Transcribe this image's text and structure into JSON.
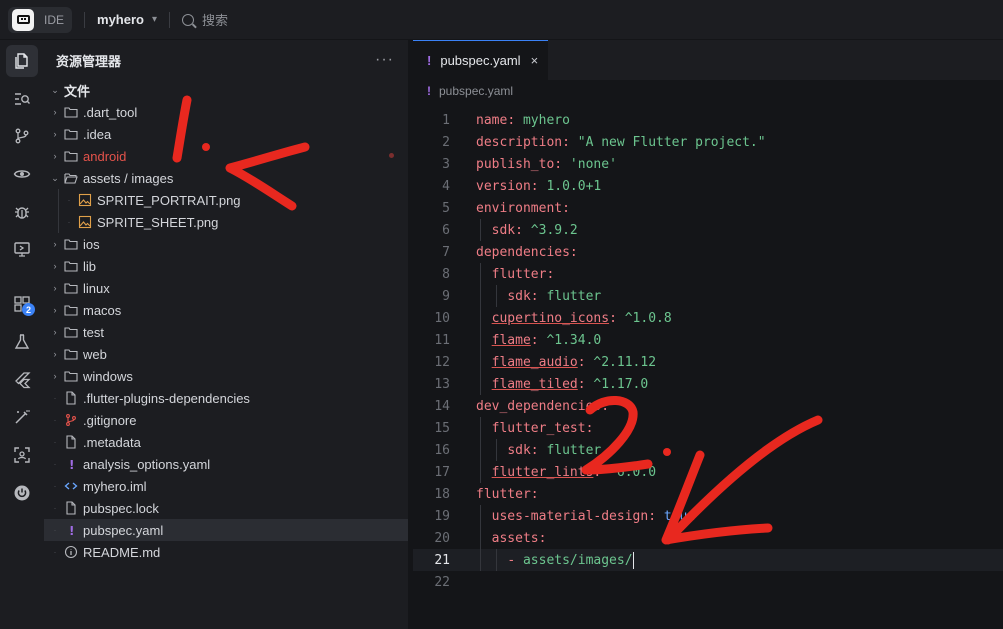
{
  "titlebar": {
    "ide_label": "IDE",
    "project_name": "myhero",
    "search_label": "搜索"
  },
  "activity_bar": {
    "items": [
      {
        "name": "explorer-icon",
        "active": true
      },
      {
        "name": "search-files-icon"
      },
      {
        "name": "source-control-icon"
      },
      {
        "name": "eye-icon"
      },
      {
        "name": "debug-icon"
      },
      {
        "name": "monitor-icon"
      },
      {
        "name": "extensions-icon",
        "badge": "2"
      },
      {
        "name": "flask-icon"
      },
      {
        "name": "flutter-icon"
      },
      {
        "name": "magic-wand-icon"
      },
      {
        "name": "scan-icon"
      },
      {
        "name": "power-icon"
      }
    ]
  },
  "explorer": {
    "title": "资源管理器",
    "more_label": "···",
    "root_label": "文件",
    "items": [
      {
        "label": ".dart_tool",
        "type": "folder"
      },
      {
        "label": ".idea",
        "type": "folder"
      },
      {
        "label": "android",
        "type": "folder",
        "status": "error"
      },
      {
        "label": "assets / images",
        "type": "folder-open"
      },
      {
        "label": "SPRITE_PORTRAIT.png",
        "type": "image"
      },
      {
        "label": "SPRITE_SHEET.png",
        "type": "image"
      },
      {
        "label": "ios",
        "type": "folder"
      },
      {
        "label": "lib",
        "type": "folder"
      },
      {
        "label": "linux",
        "type": "folder"
      },
      {
        "label": "macos",
        "type": "folder"
      },
      {
        "label": "test",
        "type": "folder"
      },
      {
        "label": "web",
        "type": "folder"
      },
      {
        "label": "windows",
        "type": "folder"
      },
      {
        "label": ".flutter-plugins-dependencies",
        "type": "file"
      },
      {
        "label": ".gitignore",
        "type": "git"
      },
      {
        "label": ".metadata",
        "type": "file"
      },
      {
        "label": "analysis_options.yaml",
        "type": "yaml"
      },
      {
        "label": "myhero.iml",
        "type": "code"
      },
      {
        "label": "pubspec.lock",
        "type": "file"
      },
      {
        "label": "pubspec.yaml",
        "type": "yaml",
        "selected": true
      },
      {
        "label": "README.md",
        "type": "info"
      }
    ]
  },
  "editor": {
    "tab_label": "pubspec.yaml",
    "tab_close": "×",
    "breadcrumb": "pubspec.yaml",
    "tab_bang": "!",
    "current_line": 21,
    "lines": [
      {
        "n": "1",
        "t": "name: myhero"
      },
      {
        "n": "2",
        "t": "description: \"A new Flutter project.\""
      },
      {
        "n": "3",
        "t": "publish_to: 'none'"
      },
      {
        "n": "4",
        "t": "version: 1.0.0+1"
      },
      {
        "n": "5",
        "t": "environment:"
      },
      {
        "n": "6",
        "t": "  sdk: ^3.9.2"
      },
      {
        "n": "7",
        "t": "dependencies:"
      },
      {
        "n": "8",
        "t": "  flutter:"
      },
      {
        "n": "9",
        "t": "    sdk: flutter"
      },
      {
        "n": "10",
        "t": "  cupertino_icons: ^1.0.8"
      },
      {
        "n": "11",
        "t": "  flame: ^1.34.0"
      },
      {
        "n": "12",
        "t": "  flame_audio: ^2.11.12"
      },
      {
        "n": "13",
        "t": "  flame_tiled: ^1.17.0"
      },
      {
        "n": "14",
        "t": "dev_dependencies:"
      },
      {
        "n": "15",
        "t": "  flutter_test:"
      },
      {
        "n": "16",
        "t": "    sdk: flutter"
      },
      {
        "n": "17",
        "t": "  flutter_lints: ^6.0.0"
      },
      {
        "n": "18",
        "t": "flutter:"
      },
      {
        "n": "19",
        "t": "  uses-material-design: true"
      },
      {
        "n": "20",
        "t": "  assets:"
      },
      {
        "n": "21",
        "t": "    - assets/images/"
      },
      {
        "n": "22",
        "t": ""
      }
    ]
  },
  "annotations": {
    "label_1": "1.",
    "label_2": "2.",
    "color": "#e8281f"
  }
}
